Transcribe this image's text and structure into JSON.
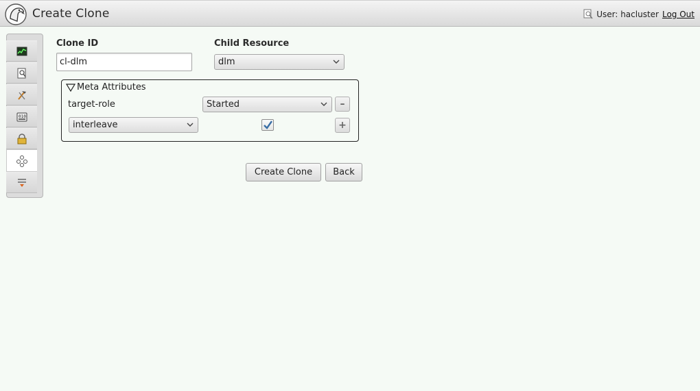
{
  "header": {
    "title": "Create Clone",
    "user_label": "User: hacluster",
    "logout_label": "Log Out"
  },
  "sidebar": {
    "items": [
      {
        "name": "monitor-icon"
      },
      {
        "name": "search-document-icon"
      },
      {
        "name": "tools-icon"
      },
      {
        "name": "config-icon"
      },
      {
        "name": "lock-icon"
      },
      {
        "name": "clone-resources-icon",
        "active": true
      },
      {
        "name": "history-icon"
      }
    ]
  },
  "form": {
    "clone_id_label": "Clone ID",
    "clone_id_value": "cl-dlm",
    "child_resource_label": "Child Resource",
    "child_resource_value": "dlm"
  },
  "meta": {
    "legend": "Meta Attributes",
    "target_role_label": "target-role",
    "target_role_value": "Started",
    "remove_label": "–",
    "new_attr_value": "interleave",
    "interleave_checked": true,
    "add_label": "+"
  },
  "actions": {
    "create_label": "Create Clone",
    "back_label": "Back"
  },
  "colors": {
    "background": "#f5faf5",
    "checkmark": "#3a6ea5"
  }
}
